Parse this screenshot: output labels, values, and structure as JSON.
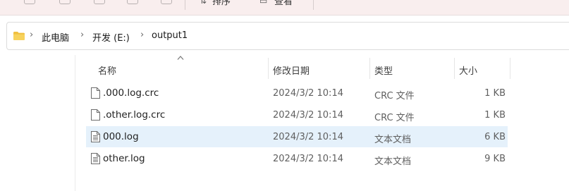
{
  "toolbar": {
    "sort_label": "排序",
    "view_label": "查看"
  },
  "address": {
    "breadcrumbs": [
      "此电脑",
      "开发 (E:)",
      "output1"
    ]
  },
  "columns": {
    "name": "名称",
    "modified": "修改日期",
    "type": "类型",
    "size": "大小"
  },
  "files": [
    {
      "name": ".000.log.crc",
      "modified": "2024/3/2 10:14",
      "type": "CRC 文件",
      "size": "1 KB",
      "icon": "blank-file-icon",
      "selected": false
    },
    {
      "name": ".other.log.crc",
      "modified": "2024/3/2 10:14",
      "type": "CRC 文件",
      "size": "1 KB",
      "icon": "blank-file-icon",
      "selected": false
    },
    {
      "name": "000.log",
      "modified": "2024/3/2 10:14",
      "type": "文本文档",
      "size": "6 KB",
      "icon": "text-file-icon",
      "selected": true
    },
    {
      "name": "other.log",
      "modified": "2024/3/2 10:14",
      "type": "文本文档",
      "size": "9 KB",
      "icon": "text-file-icon",
      "selected": false
    }
  ],
  "colors": {
    "selected_row": "#e5f1fb",
    "toolbar_bg": "#f9eeee",
    "folder": "#f0c040"
  }
}
